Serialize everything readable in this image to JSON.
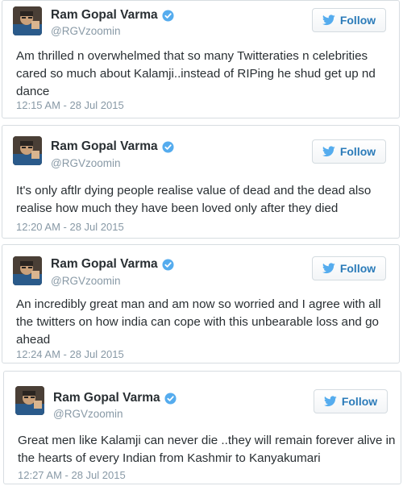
{
  "account": {
    "display_name": "Ram Gopal Varma",
    "handle": "@RGVzoomin",
    "follow_label": "Follow",
    "verified_color": "#55acee",
    "follow_text_color": "#2b7bb9"
  },
  "tweets": [
    {
      "text": "Am thrilled n overwhelmed that so many Twitteraties n celebrities cared so much about Kalamji..instead of RIPing he shud get up nd dance",
      "timestamp": "12:15 AM - 28 Jul 2015"
    },
    {
      "text": "It's only aftlr dying people realise value of dead and the dead also realise how much they have been loved only after they died",
      "timestamp": "12:20 AM - 28 Jul 2015"
    },
    {
      "text": "An incredibly great man and am now so worried and I agree with all the twitters on how india can cope with this unbearable loss and go ahead",
      "timestamp": "12:24 AM - 28 Jul 2015"
    },
    {
      "text": "Great men like Kalamji can never die ..they will remain forever alive in the hearts of every Indian from Kashmir to Kanyakumari",
      "timestamp": "12:27 AM - 28 Jul 2015"
    }
  ]
}
